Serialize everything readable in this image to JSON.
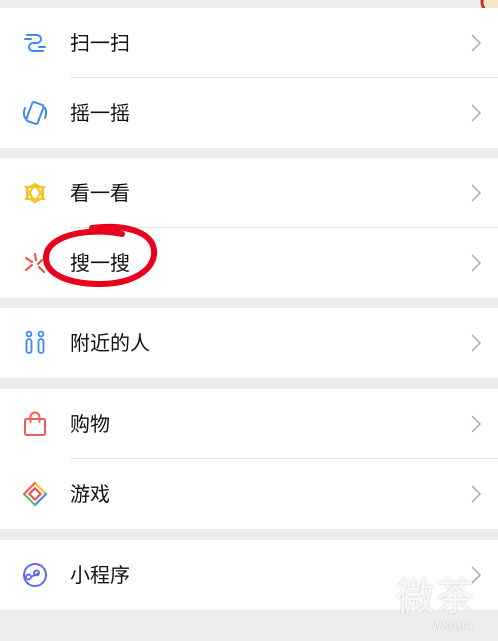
{
  "menu": {
    "scan": {
      "label": "扫一扫",
      "icon": "scan-icon"
    },
    "shake": {
      "label": "摇一摇",
      "icon": "shake-icon"
    },
    "top_stories": {
      "label": "看一看",
      "icon": "top-stories-icon"
    },
    "search": {
      "label": "搜一搜",
      "icon": "search-icon"
    },
    "nearby": {
      "label": "附近的人",
      "icon": "people-nearby-icon"
    },
    "shopping": {
      "label": "购物",
      "icon": "shopping-bag-icon"
    },
    "games": {
      "label": "游戏",
      "icon": "games-icon"
    },
    "mini_programs": {
      "label": "小程序",
      "icon": "mini-program-icon"
    }
  },
  "annotation": {
    "color": "#e8001c",
    "target": "search"
  },
  "watermark": {
    "text_cn": "微茶",
    "text_en": "WXCHA"
  },
  "colors": {
    "background": "#ededed",
    "row": "#ffffff",
    "divider": "#e5e5e5",
    "chevron": "#b2b2b2",
    "scan": "#3e8af0",
    "top_stories": "#f6c525",
    "search": "#f04a3d",
    "nearby": "#3c8ced",
    "shopping": "#f25c5c",
    "mini_program": "#6467f0"
  }
}
